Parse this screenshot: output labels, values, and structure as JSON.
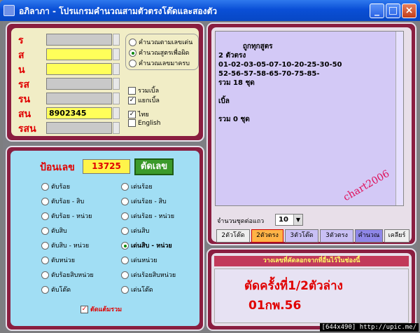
{
  "window": {
    "title": "อภิลาภา - โปรแกรมคำนวณสามตัวตรงโต๊ดและสองตัว",
    "icon": "app-icon"
  },
  "input_panel": {
    "rows": [
      {
        "label": "ร",
        "value": "",
        "highlight": false
      },
      {
        "label": "ส",
        "value": "",
        "highlight": true
      },
      {
        "label": "น",
        "value": "",
        "highlight": true
      },
      {
        "label": "รส",
        "value": "",
        "highlight": false
      },
      {
        "label": "รน",
        "value": "",
        "highlight": false
      },
      {
        "label": "สน",
        "value": "8902345",
        "highlight": true
      },
      {
        "label": "รสน",
        "value": "",
        "highlight": false
      }
    ],
    "modes": [
      {
        "label": "คำนวณตามเลขเด่น",
        "selected": false
      },
      {
        "label": "คำนวณสูตรเพื่อผิด",
        "selected": true
      },
      {
        "label": "คำนวณเลขมาครบ",
        "selected": false
      }
    ],
    "checks": [
      {
        "label": "รวมเบิ้ล",
        "checked": false
      },
      {
        "label": "แยกเบิ้ล",
        "checked": true
      },
      {
        "label": "ไทย",
        "checked": true
      },
      {
        "label": "English",
        "checked": false
      }
    ]
  },
  "calc_panel": {
    "input_label": "ป้อนเลข",
    "input_value": "13725",
    "cut_button": "ตัดเลข",
    "options_left": [
      "ตับร้อย",
      "ตับร้อย - สิบ",
      "ตับร้อย - หน่วย",
      "ตับสิบ",
      "ตับสิบ - หน่วย",
      "ตับหน่วย",
      "ตับร้อยสิบหน่วย",
      "ตับโต๊ด"
    ],
    "options_right": [
      "เด่นร้อย",
      "เด่นร้อย - สิบ",
      "เด่นร้อย - หน่วย",
      "เด่นสิบ",
      "เด่นสิบ - หน่วย",
      "เด่นหน่วย",
      "เด่นร้อยสิบหน่วย",
      "เด่นโต๊ด"
    ],
    "selected_right_index": 4,
    "merge_check": "ตัดแต้มรวม",
    "merge_checked": true
  },
  "output_panel": {
    "text": "ถูกทุกสูตร\n2 ตัวตรง\n01-02-03-05-07-10-20-25-30-50\n52-56-57-58-65-70-75-85-\nรวม 18 ชุด\n\nเบิ้ล\n\nรวม 0 ชุด",
    "watermark": "chart2006",
    "per_row_label": "จำนวนชุดต่อแถว",
    "per_row_value": "10",
    "tabs": [
      "2ตัวโต๊ด",
      "2ตัวตรง",
      "3ตัวโต๊ด",
      "3ตัวตรง",
      "คำนวณ",
      "เคลียร์"
    ],
    "active_tab": 1
  },
  "note_panel": {
    "header": "วางเลขที่คัดลอกจากที่อื่นไว้ในช่องนี้",
    "line1": "ตัดครั้งที่1/2ตัวล่าง",
    "line2": "01กพ.56"
  },
  "footer_watermark": "[644x490] http://upic.me/",
  "colors": {
    "accent": "#0a4fd6",
    "frame": "#8a1e40",
    "red_text": "#e00000",
    "yellow_field": "#ffff5a",
    "calc_bg": "#a1def4"
  }
}
